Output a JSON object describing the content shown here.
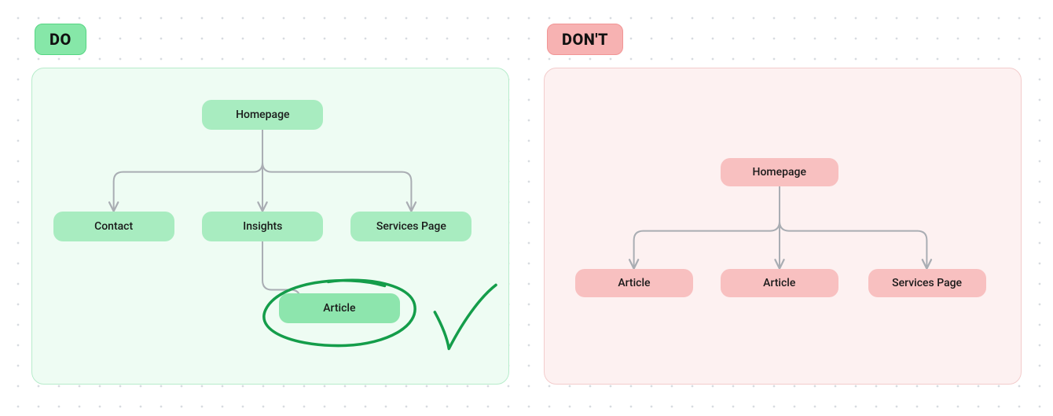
{
  "do": {
    "badge": "DO",
    "nodes": {
      "home": "Homepage",
      "contact": "Contact",
      "insights": "Insights",
      "services": "Services Page",
      "article": "Article"
    }
  },
  "dont": {
    "badge": "DON'T",
    "nodes": {
      "home": "Homepage",
      "article1": "Article",
      "article2": "Article",
      "services": "Services Page"
    }
  },
  "colors": {
    "doPanelBg": "#eefcf3",
    "doNode": "#a8ecc0",
    "dontPanelBg": "#fdf1f1",
    "dontNode": "#f8c0c0",
    "connector": "#a9adb3",
    "scribble": "#149d4a"
  }
}
